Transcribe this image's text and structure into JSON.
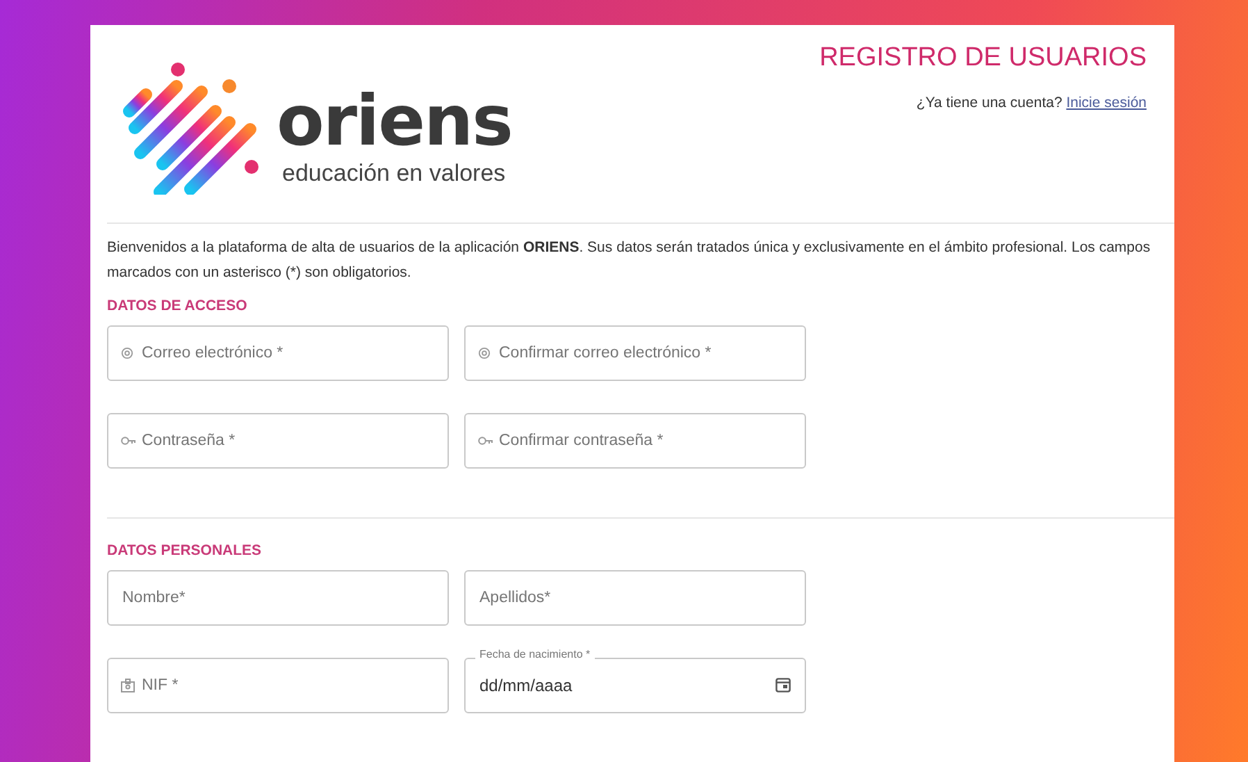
{
  "header": {
    "logo_name": "oriens",
    "logo_tagline": "educación en valores",
    "title": "REGISTRO DE USUARIOS",
    "account_prompt": "¿Ya tiene una cuenta?",
    "login_link": "Inicie sesión"
  },
  "intro": "Bienvenidos a la plataforma de alta de usuarios de la aplicación **ORIENS**. Sus datos serán tratados única y exclusivamente en el ámbito profesional. Los campos marcados con un asterisco (*) son obligatorios.",
  "sections": [
    {
      "title": "DATOS DE ACCESO",
      "fields": [
        {
          "kind": "email",
          "placeholder": "Correo electrónico *"
        },
        {
          "kind": "email",
          "placeholder": "Confirmar correo electrónico *"
        },
        {
          "kind": "password",
          "placeholder": "Contraseña *"
        },
        {
          "kind": "password",
          "placeholder": "Confirmar contraseña *"
        }
      ]
    },
    {
      "title": "DATOS PERSONALES",
      "fields": [
        {
          "kind": "text",
          "placeholder": "Nombre*"
        },
        {
          "kind": "text",
          "placeholder": "Apellidos*"
        },
        {
          "kind": "document",
          "placeholder": "NIF *"
        },
        {
          "kind": "date",
          "label": "Fecha de nacimiento *",
          "value": "dd/mm/aaaa"
        }
      ]
    }
  ]
}
